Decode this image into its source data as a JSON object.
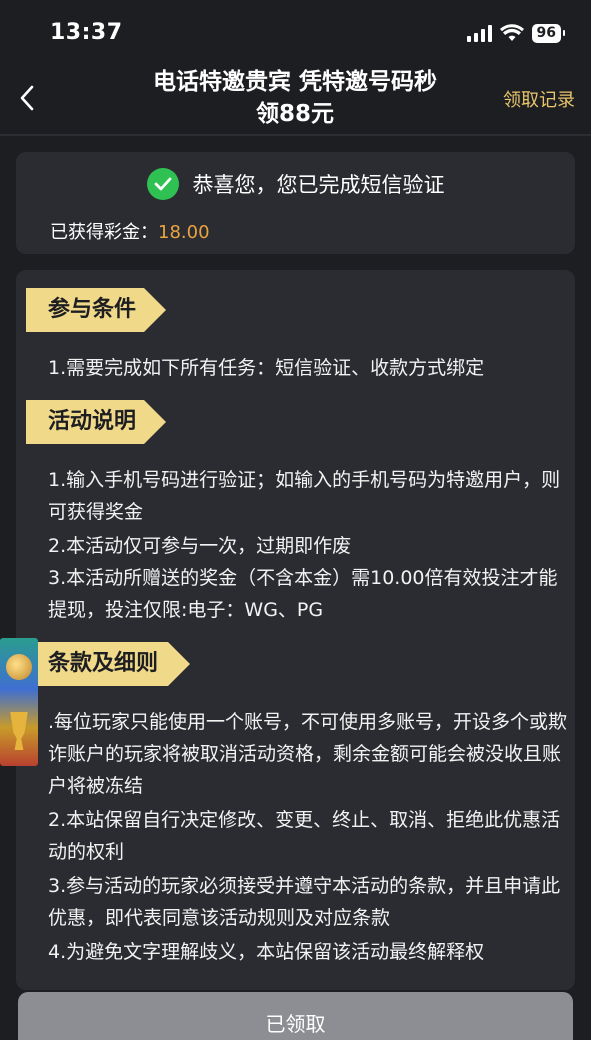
{
  "status_bar": {
    "time": "13:37",
    "battery": "96"
  },
  "nav": {
    "title_line1": "电话特邀贵宾 凭特邀号码秒",
    "title_line2": "领88元",
    "record_link": "领取记录"
  },
  "verify": {
    "message": "恭喜您，您已完成短信验证",
    "bonus_label": "已获得彩金：",
    "bonus_value": "18.00"
  },
  "sections": {
    "conditions": {
      "title": "参与条件",
      "lines": [
        "1.需要完成如下所有任务：短信验证、收款方式绑定"
      ]
    },
    "description": {
      "title": "活动说明",
      "lines": [
        "1.输入手机号码进行验证；如输入的手机号码为特邀用户，则可获得奖金",
        "2.本活动仅可参与一次，过期即作废",
        "3.本活动所赠送的奖金（不含本金）需10.00倍有效投注才能提现，投注仅限:电子：WG、PG"
      ]
    },
    "terms": {
      "title": "条款及细则",
      "lines": [
        ".每位玩家只能使用一个账号，不可使用多账号，开设多个或欺诈账户的玩家将被取消活动资格，剩余金额可能会被没收且账户将被冻结",
        "2.本站保留自行决定修改、变更、终止、取消、拒绝此优惠活动的权利",
        "3.参与活动的玩家必须接受并遵守本活动的条款，并且申请此优惠，即代表同意该活动规则及对应条款",
        "4.为避免文字理解歧义，本站保留该活动最终解释权"
      ]
    }
  },
  "footer": {
    "claimed_label": "已领取"
  },
  "colors": {
    "background": "#1d1e22",
    "card": "#2b2c31",
    "accent_gold": "#e9c56c",
    "bonus_orange": "#e9a340",
    "ribbon": "#f1d98a",
    "success_green": "#2fc151",
    "disabled_button": "#8d8e93"
  },
  "icons": {
    "back": "chevron-left-icon",
    "check": "check-circle-icon",
    "signal": "cellular-signal-icon",
    "wifi": "wifi-icon",
    "battery": "battery-icon"
  }
}
